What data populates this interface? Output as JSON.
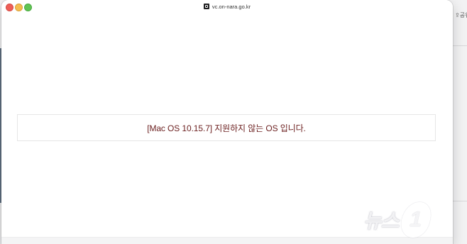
{
  "window": {
    "url": "vc.on-nara.go.kr",
    "site_icon": "site-favicon-icon"
  },
  "message": {
    "text": "[Mac OS 10.15.7] 지원하지 않는 OS 입니다."
  },
  "background_app": {
    "share_label": "공유"
  },
  "watermark": {
    "text": "뉴스",
    "badge": "1"
  },
  "colors": {
    "message_text": "#6b1f1f",
    "traffic_close": "#ee5e57",
    "traffic_minimize": "#f5bd4f",
    "traffic_zoom": "#60c454",
    "sidebar_strip": "#5e6f80"
  }
}
